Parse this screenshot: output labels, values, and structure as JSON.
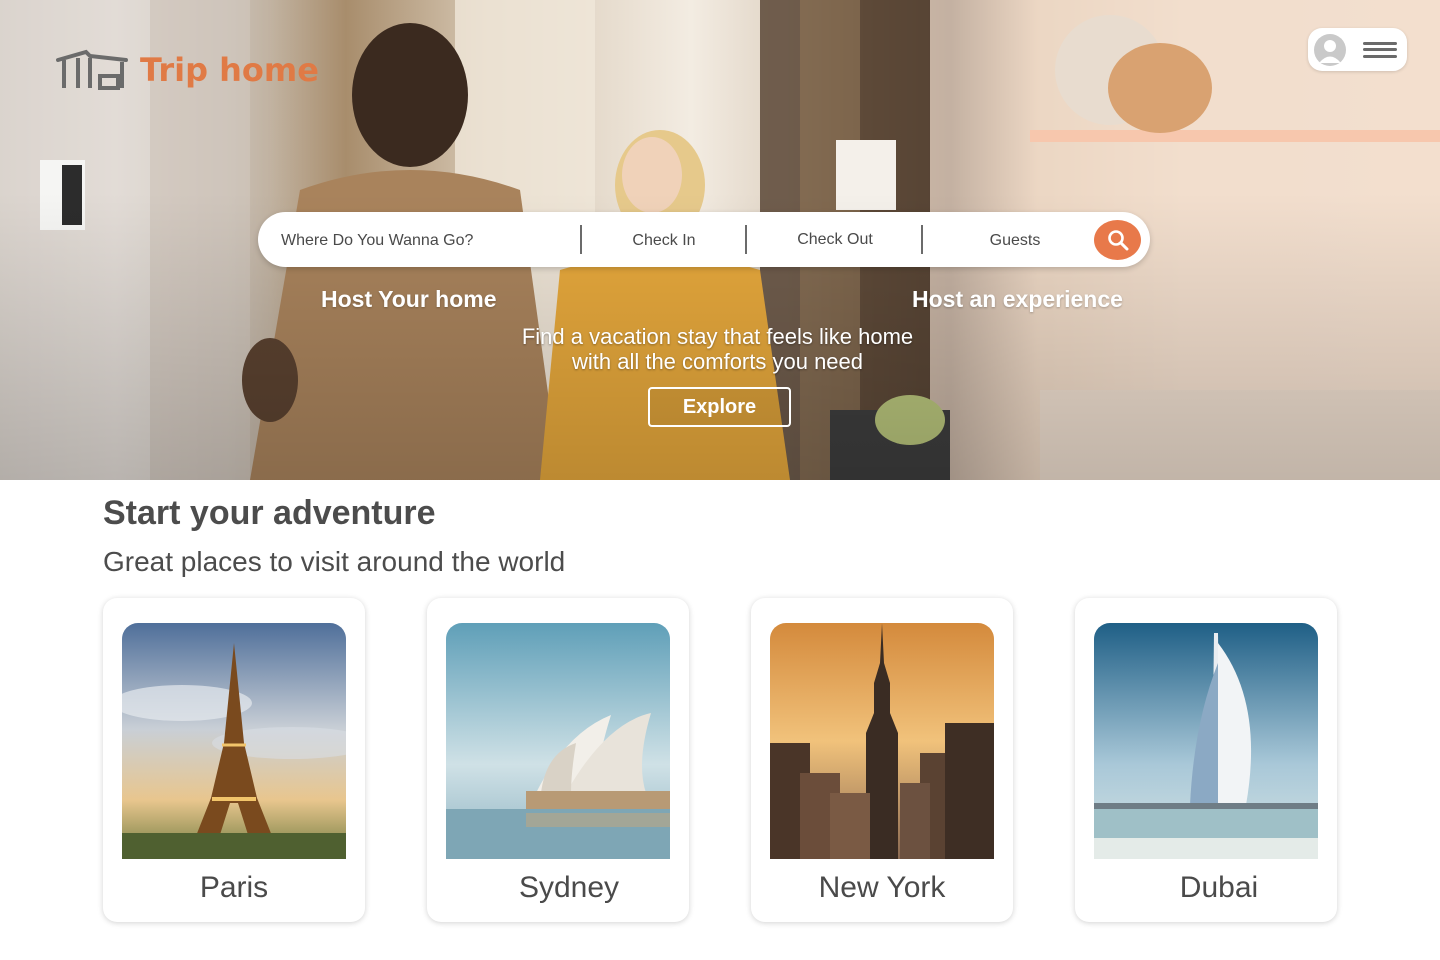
{
  "brand": {
    "name": "Trip home",
    "accent": "#e07a45"
  },
  "header": {
    "user_icon": "user-avatar-icon",
    "menu_icon": "hamburger-menu-icon"
  },
  "search": {
    "destination_placeholder": "Where Do You Wanna Go?",
    "check_in": "Check In",
    "check_out": "Check Out",
    "guests": "Guests",
    "button_icon": "search-icon",
    "button_color": "#e8794a"
  },
  "hero": {
    "host_home": "Host Your home",
    "host_experience": "Host an experience",
    "tagline_line1": "Find a vacation stay that feels like home",
    "tagline_line2": "with all the comforts you need",
    "explore": "Explore"
  },
  "section": {
    "title": "Start your adventure",
    "subtitle": "Great places to visit around the world"
  },
  "destinations": [
    {
      "name": "Paris"
    },
    {
      "name": "Sydney"
    },
    {
      "name": "New York"
    },
    {
      "name": "Dubai"
    }
  ]
}
